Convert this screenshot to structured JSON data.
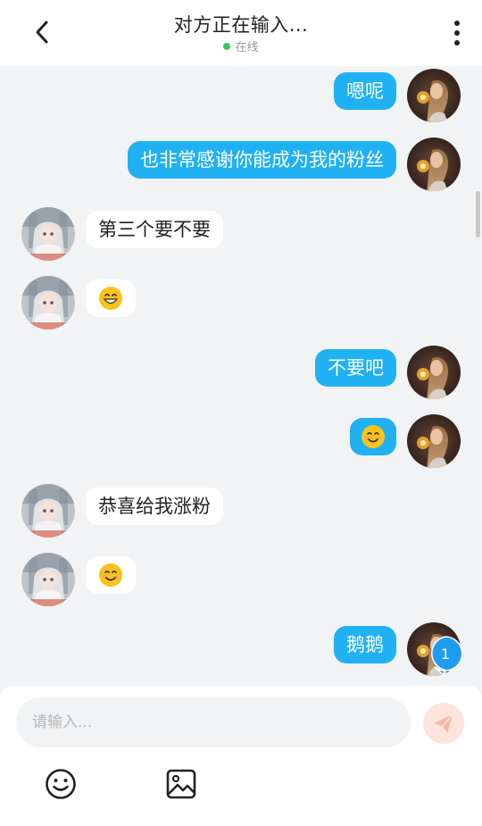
{
  "header": {
    "title": "对方正在输入...",
    "status": "在线",
    "status_color": "#34c759"
  },
  "messages": [
    {
      "side": "right",
      "type": "text",
      "text": "嗯呢"
    },
    {
      "side": "right",
      "type": "text",
      "text": "也非常感谢你能成为我的粉丝"
    },
    {
      "side": "left",
      "type": "text",
      "text": "第三个要不要"
    },
    {
      "side": "left",
      "type": "emoji",
      "emoji": "grinning-face-emoji"
    },
    {
      "side": "right",
      "type": "text",
      "text": "不要吧"
    },
    {
      "side": "right",
      "type": "emoji",
      "emoji": "smiling-face-emoji"
    },
    {
      "side": "left",
      "type": "text",
      "text": "恭喜给我涨粉"
    },
    {
      "side": "left",
      "type": "emoji",
      "emoji": "smiling-face-emoji"
    },
    {
      "side": "right",
      "type": "text",
      "text": "鹅鹅"
    }
  ],
  "unread_badge": "1",
  "composer": {
    "placeholder": "请输入...",
    "send_icon": "paper-plane-icon",
    "tools": [
      "smiley-icon",
      "image-icon"
    ]
  },
  "colors": {
    "outgoing_bubble": "#20b1f3",
    "incoming_bubble": "#ffffff",
    "background": "#f1f3f5",
    "send_button": "#fde4dd",
    "badge": "#1e9cf0"
  }
}
